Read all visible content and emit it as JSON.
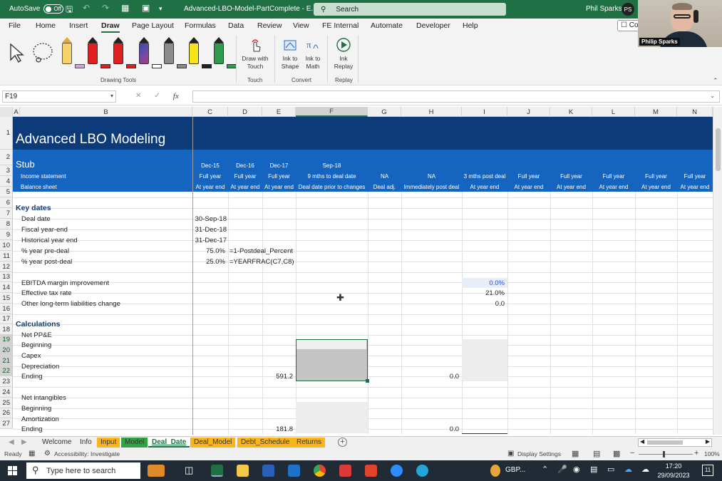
{
  "titlebar": {
    "autosave_label": "AutoSave",
    "autosave_state": "Off",
    "filename": "Advanced-LBO-Model-PartComplete - E...",
    "search_placeholder": "Search",
    "user_name": "Phil Sparks",
    "user_initials": "PS"
  },
  "video": {
    "name": "Philip Sparks"
  },
  "menu": {
    "tabs": [
      "File",
      "Home",
      "Insert",
      "Draw",
      "Page Layout",
      "Formulas",
      "Data",
      "Review",
      "View",
      "FE Internal",
      "Automate",
      "Developer",
      "Help"
    ],
    "active": "Draw",
    "comments_label": "Co"
  },
  "ribbon": {
    "groups": {
      "drawing_tools": "Drawing Tools",
      "touch": "Touch",
      "convert": "Convert",
      "replay": "Replay"
    },
    "buttons": {
      "draw_with_touch": [
        "Draw with",
        "Touch"
      ],
      "ink_to_shape": [
        "Ink to",
        "Shape"
      ],
      "ink_to_math": [
        "Ink to",
        "Math"
      ],
      "ink_replay": [
        "Ink",
        "Replay"
      ]
    },
    "pen_colors": [
      "#f5d36b",
      "#e02020",
      "#e02020",
      "#3a4aa6",
      "#8a8a8a",
      "#f7e51a",
      "#2e9b4e"
    ]
  },
  "formula_bar": {
    "name_box": "F19",
    "fx_label": "fx",
    "cancel_glyph": "✕",
    "enter_glyph": "✓",
    "formula": ""
  },
  "grid": {
    "columns": [
      "A",
      "B",
      "C",
      "D",
      "E",
      "F",
      "G",
      "H",
      "I",
      "J",
      "K",
      "L",
      "M",
      "N"
    ],
    "selected_column": "F",
    "selected_rows": [
      "19",
      "20",
      "21",
      "22"
    ],
    "row_numbers": [
      "1",
      "2",
      "3",
      "4",
      "5",
      "6",
      "7",
      "8",
      "9",
      "10",
      "11",
      "12",
      "13",
      "14",
      "15",
      "16",
      "17",
      "18",
      "19",
      "20",
      "21",
      "22",
      "23",
      "24",
      "25",
      "26",
      "27"
    ],
    "title": "Advanced LBO Modeling",
    "stub": "Stub",
    "header_rows": {
      "row2": {
        "C": "Dec-15",
        "D": "Dec-16",
        "E": "Dec-17",
        "F": "Sep-18"
      },
      "row3": {
        "B": "Income statement",
        "C": "Full year",
        "D": "Full year",
        "E": "Full year",
        "F": "9 mths to deal date",
        "G": "NA",
        "H": "NA",
        "I": "3 mths post deal",
        "J": "Full year",
        "K": "Full year",
        "L": "Full year",
        "M": "Full year",
        "N": "Full year"
      },
      "row4": {
        "B": "Balance sheet",
        "C": "At year end",
        "D": "At year end",
        "E": "At year end",
        "F": "Deal date prior to changes",
        "G": "Deal adj.",
        "H": "Immediately post deal",
        "I": "At year end",
        "J": "At year end",
        "K": "At year end",
        "L": "At year end",
        "M": "At year end",
        "N": "At year end"
      }
    },
    "key_dates": {
      "heading": "Key dates",
      "deal_date_label": "Deal date",
      "deal_date_value": "30-Sep-18",
      "fiscal_ye_label": "Fiscal year-end",
      "fiscal_ye_value": "31-Dec-18",
      "hist_ye_label": "Historical year end",
      "hist_ye_value": "31-Dec-17",
      "pre_deal_label": "% year pre-deal",
      "pre_deal_value": "75.0%",
      "pre_deal_formula": "=1-Postdeal_Percent",
      "post_deal_label": "% year post-deal",
      "post_deal_value": "25.0%",
      "post_deal_formula": "=YEARFRAC(C7,C8)"
    },
    "assumptions": {
      "ebitda_label": "EBITDA margin improvement",
      "ebitda_value": "0.0%",
      "tax_label": "Effective tax rate",
      "tax_value": "21.0%",
      "ltl_label": "Other long-term liabilities change",
      "ltl_value": "0.0"
    },
    "calculations": {
      "heading": "Calculations",
      "net_ppe": "Net PP&E",
      "beginning": "Beginning",
      "capex": "Capex",
      "depreciation": "Depreciation",
      "ending": "Ending",
      "ppe_ending_E": "591.2",
      "ppe_ending_H": "0.0",
      "net_intangibles": "Net intangibles",
      "beginning2": "Beginning",
      "amortization": "Amortization",
      "ending2": "Ending",
      "int_ending_E": "181.8",
      "int_ending_H": "0.0"
    }
  },
  "sheets": {
    "tabs": [
      "Welcome",
      "Info",
      "Input",
      "Model",
      "Deal_Date",
      "Deal_Model",
      "Debt_Schedule",
      "Returns"
    ],
    "active": "Deal_Date"
  },
  "status": {
    "ready": "Ready",
    "accessibility": "Accessibility: Investigate",
    "display_settings": "Display Settings",
    "zoom": "100%"
  },
  "taskbar": {
    "search_placeholder": "Type here to search",
    "currency": "GBP...",
    "time": "17:20",
    "date": "29/09/2023",
    "notifications": "11"
  }
}
